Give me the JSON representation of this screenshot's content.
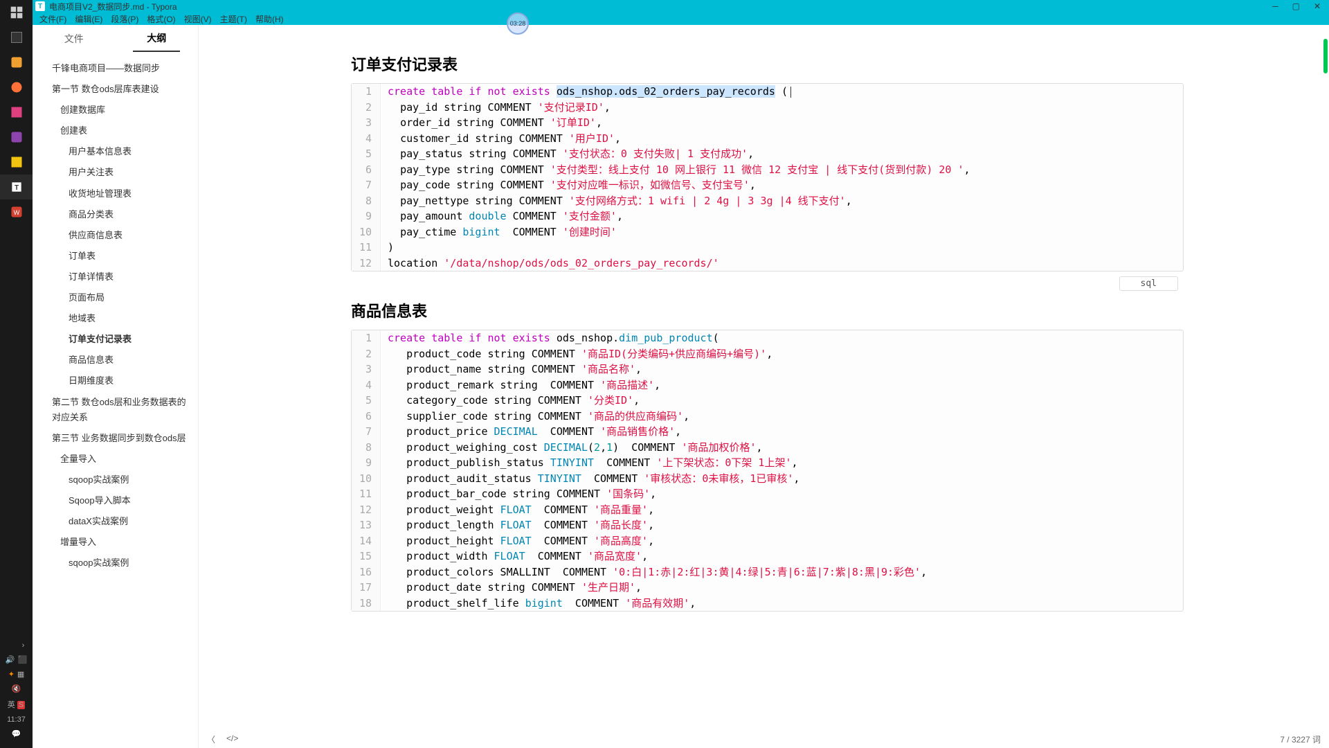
{
  "window": {
    "title": "电商项目V2_数据同步.md - Typora",
    "icon_letter": "T"
  },
  "menu": [
    "文件(F)",
    "编辑(E)",
    "段落(P)",
    "格式(O)",
    "视图(V)",
    "主题(T)",
    "帮助(H)"
  ],
  "sidebar": {
    "tabs": {
      "files": "文件",
      "outline": "大纲"
    },
    "outline": [
      {
        "level": 1,
        "text": "千锋电商项目——数据同步"
      },
      {
        "level": 1,
        "text": "第一节 数仓ods层库表建设"
      },
      {
        "level": 2,
        "text": "创建数据库"
      },
      {
        "level": 2,
        "text": "创建表"
      },
      {
        "level": 3,
        "text": "用户基本信息表"
      },
      {
        "level": 3,
        "text": "用户关注表"
      },
      {
        "level": 3,
        "text": "收货地址管理表"
      },
      {
        "level": 3,
        "text": "商品分类表"
      },
      {
        "level": 3,
        "text": "供应商信息表"
      },
      {
        "level": 3,
        "text": "订单表"
      },
      {
        "level": 3,
        "text": "订单详情表"
      },
      {
        "level": 3,
        "text": "页面布局"
      },
      {
        "level": 3,
        "text": "地域表"
      },
      {
        "level": 3,
        "text": "订单支付记录表",
        "active": true
      },
      {
        "level": 3,
        "text": "商品信息表"
      },
      {
        "level": 3,
        "text": "日期维度表"
      },
      {
        "level": 1,
        "text": "第二节 数仓ods层和业务数据表的对应关系"
      },
      {
        "level": 1,
        "text": "第三节 业务数据同步到数仓ods层"
      },
      {
        "level": 2,
        "text": "全量导入"
      },
      {
        "level": 3,
        "text": "sqoop实战案例"
      },
      {
        "level": 3,
        "text": "Sqoop导入脚本"
      },
      {
        "level": 3,
        "text": "dataX实战案例"
      },
      {
        "level": 2,
        "text": "增量导入"
      },
      {
        "level": 3,
        "text": "sqoop实战案例"
      }
    ]
  },
  "headings": {
    "h1": "订单支付记录表",
    "h2": "商品信息表"
  },
  "code1": {
    "lang": "sql",
    "lines": [
      {
        "n": 1,
        "segs": [
          {
            "t": "create",
            "c": "kw"
          },
          {
            "t": " "
          },
          {
            "t": "table",
            "c": "kw"
          },
          {
            "t": " "
          },
          {
            "t": "if",
            "c": "kw"
          },
          {
            "t": " "
          },
          {
            "t": "not",
            "c": "kw"
          },
          {
            "t": " "
          },
          {
            "t": "exists",
            "c": "kw"
          },
          {
            "t": " "
          },
          {
            "t": "ods_nshop.ods_02_orders_pay_records",
            "c": "hl"
          },
          {
            "t": " ("
          }
        ],
        "cursor": true
      },
      {
        "n": 2,
        "segs": [
          {
            "t": "  pay_id string COMMENT "
          },
          {
            "t": "'支付记录ID'",
            "c": "str"
          },
          {
            "t": ","
          }
        ]
      },
      {
        "n": 3,
        "segs": [
          {
            "t": "  order_id string COMMENT "
          },
          {
            "t": "'订单ID'",
            "c": "str"
          },
          {
            "t": ","
          }
        ]
      },
      {
        "n": 4,
        "segs": [
          {
            "t": "  customer_id string COMMENT "
          },
          {
            "t": "'用户ID'",
            "c": "str"
          },
          {
            "t": ","
          }
        ]
      },
      {
        "n": 5,
        "segs": [
          {
            "t": "  pay_status string COMMENT "
          },
          {
            "t": "'支付状态：0 支付失败| 1 支付成功'",
            "c": "str"
          },
          {
            "t": ","
          }
        ]
      },
      {
        "n": 6,
        "segs": [
          {
            "t": "  pay_type string COMMENT "
          },
          {
            "t": "'支付类型：线上支付 10 网上银行 11 微信 12 支付宝 | 线下支付(货到付款) 20 '",
            "c": "str"
          },
          {
            "t": ","
          }
        ]
      },
      {
        "n": 7,
        "segs": [
          {
            "t": "  pay_code string COMMENT "
          },
          {
            "t": "'支付对应唯一标识，如微信号、支付宝号'",
            "c": "str"
          },
          {
            "t": ","
          }
        ]
      },
      {
        "n": 8,
        "segs": [
          {
            "t": "  pay_nettype string COMMENT "
          },
          {
            "t": "'支付网络方式：1 wifi | 2 4g | 3 3g |4 线下支付'",
            "c": "str"
          },
          {
            "t": ","
          }
        ]
      },
      {
        "n": 9,
        "segs": [
          {
            "t": "  pay_amount "
          },
          {
            "t": "double",
            "c": "type"
          },
          {
            "t": " COMMENT "
          },
          {
            "t": "'支付金额'",
            "c": "str"
          },
          {
            "t": ","
          }
        ]
      },
      {
        "n": 10,
        "segs": [
          {
            "t": "  pay_ctime "
          },
          {
            "t": "bigint",
            "c": "type"
          },
          {
            "t": "  COMMENT "
          },
          {
            "t": "'创建时间'",
            "c": "str"
          }
        ]
      },
      {
        "n": 11,
        "segs": [
          {
            "t": ")"
          }
        ]
      },
      {
        "n": 12,
        "segs": [
          {
            "t": "location "
          },
          {
            "t": "'/data/nshop/ods/ods_02_orders_pay_records/'",
            "c": "str"
          }
        ]
      }
    ]
  },
  "code2": {
    "lines": [
      {
        "n": 1,
        "segs": [
          {
            "t": "create",
            "c": "kw"
          },
          {
            "t": " "
          },
          {
            "t": "table",
            "c": "kw"
          },
          {
            "t": " "
          },
          {
            "t": "if",
            "c": "kw"
          },
          {
            "t": " "
          },
          {
            "t": "not",
            "c": "kw"
          },
          {
            "t": " "
          },
          {
            "t": "exists",
            "c": "kw"
          },
          {
            "t": " ods_nshop."
          },
          {
            "t": "dim_pub_product",
            "c": "type"
          },
          {
            "t": "("
          }
        ]
      },
      {
        "n": 2,
        "segs": [
          {
            "t": "   product_code string COMMENT "
          },
          {
            "t": "'商品ID(分类编码+供应商编码+编号)'",
            "c": "str"
          },
          {
            "t": ","
          }
        ]
      },
      {
        "n": 3,
        "segs": [
          {
            "t": "   product_name string COMMENT "
          },
          {
            "t": "'商品名称'",
            "c": "str"
          },
          {
            "t": ","
          }
        ]
      },
      {
        "n": 4,
        "segs": [
          {
            "t": "   product_remark string  COMMENT "
          },
          {
            "t": "'商品描述'",
            "c": "str"
          },
          {
            "t": ","
          }
        ]
      },
      {
        "n": 5,
        "segs": [
          {
            "t": "   category_code string COMMENT "
          },
          {
            "t": "'分类ID'",
            "c": "str"
          },
          {
            "t": ","
          }
        ]
      },
      {
        "n": 6,
        "segs": [
          {
            "t": "   supplier_code string COMMENT "
          },
          {
            "t": "'商品的供应商编码'",
            "c": "str"
          },
          {
            "t": ","
          }
        ]
      },
      {
        "n": 7,
        "segs": [
          {
            "t": "   product_price "
          },
          {
            "t": "DECIMAL",
            "c": "type"
          },
          {
            "t": "  COMMENT "
          },
          {
            "t": "'商品销售价格'",
            "c": "str"
          },
          {
            "t": ","
          }
        ]
      },
      {
        "n": 8,
        "segs": [
          {
            "t": "   product_weighing_cost "
          },
          {
            "t": "DECIMAL",
            "c": "type"
          },
          {
            "t": "("
          },
          {
            "t": "2",
            "c": "num"
          },
          {
            "t": ","
          },
          {
            "t": "1",
            "c": "num"
          },
          {
            "t": ")  COMMENT "
          },
          {
            "t": "'商品加权价格'",
            "c": "str"
          },
          {
            "t": ","
          }
        ]
      },
      {
        "n": 9,
        "segs": [
          {
            "t": "   product_publish_status "
          },
          {
            "t": "TINYINT",
            "c": "type"
          },
          {
            "t": "  COMMENT "
          },
          {
            "t": "'上下架状态：0下架 1上架'",
            "c": "str"
          },
          {
            "t": ","
          }
        ]
      },
      {
        "n": 10,
        "segs": [
          {
            "t": "   product_audit_status "
          },
          {
            "t": "TINYINT",
            "c": "type"
          },
          {
            "t": "  COMMENT "
          },
          {
            "t": "'审核状态：0未审核，1已审核'",
            "c": "str"
          },
          {
            "t": ","
          }
        ]
      },
      {
        "n": 11,
        "segs": [
          {
            "t": "   product_bar_code string COMMENT "
          },
          {
            "t": "'国条码'",
            "c": "str"
          },
          {
            "t": ","
          }
        ]
      },
      {
        "n": 12,
        "segs": [
          {
            "t": "   product_weight "
          },
          {
            "t": "FLOAT",
            "c": "type"
          },
          {
            "t": "  COMMENT "
          },
          {
            "t": "'商品重量'",
            "c": "str"
          },
          {
            "t": ","
          }
        ]
      },
      {
        "n": 13,
        "segs": [
          {
            "t": "   product_length "
          },
          {
            "t": "FLOAT",
            "c": "type"
          },
          {
            "t": "  COMMENT "
          },
          {
            "t": "'商品长度'",
            "c": "str"
          },
          {
            "t": ","
          }
        ]
      },
      {
        "n": 14,
        "segs": [
          {
            "t": "   product_height "
          },
          {
            "t": "FLOAT",
            "c": "type"
          },
          {
            "t": "  COMMENT "
          },
          {
            "t": "'商品高度'",
            "c": "str"
          },
          {
            "t": ","
          }
        ]
      },
      {
        "n": 15,
        "segs": [
          {
            "t": "   product_width "
          },
          {
            "t": "FLOAT",
            "c": "type"
          },
          {
            "t": "  COMMENT "
          },
          {
            "t": "'商品宽度'",
            "c": "str"
          },
          {
            "t": ","
          }
        ]
      },
      {
        "n": 16,
        "segs": [
          {
            "t": "   product_colors SMALLINT  COMMENT "
          },
          {
            "t": "'0:白|1:赤|2:红|3:黄|4:绿|5:青|6:蓝|7:紫|8:黑|9:彩色'",
            "c": "str"
          },
          {
            "t": ","
          }
        ]
      },
      {
        "n": 17,
        "segs": [
          {
            "t": "   product_date string COMMENT "
          },
          {
            "t": "'生产日期'",
            "c": "str"
          },
          {
            "t": ","
          }
        ]
      },
      {
        "n": 18,
        "segs": [
          {
            "t": "   product_shelf_life "
          },
          {
            "t": "bigint",
            "c": "type"
          },
          {
            "t": "  COMMENT "
          },
          {
            "t": "'商品有效期'",
            "c": "str"
          },
          {
            "t": ","
          }
        ]
      }
    ]
  },
  "status": {
    "words": "7 / 3227 词"
  },
  "timer": "03:28",
  "taskbar_time": "11:37",
  "ime": {
    "lang": "英",
    "s": "S"
  }
}
